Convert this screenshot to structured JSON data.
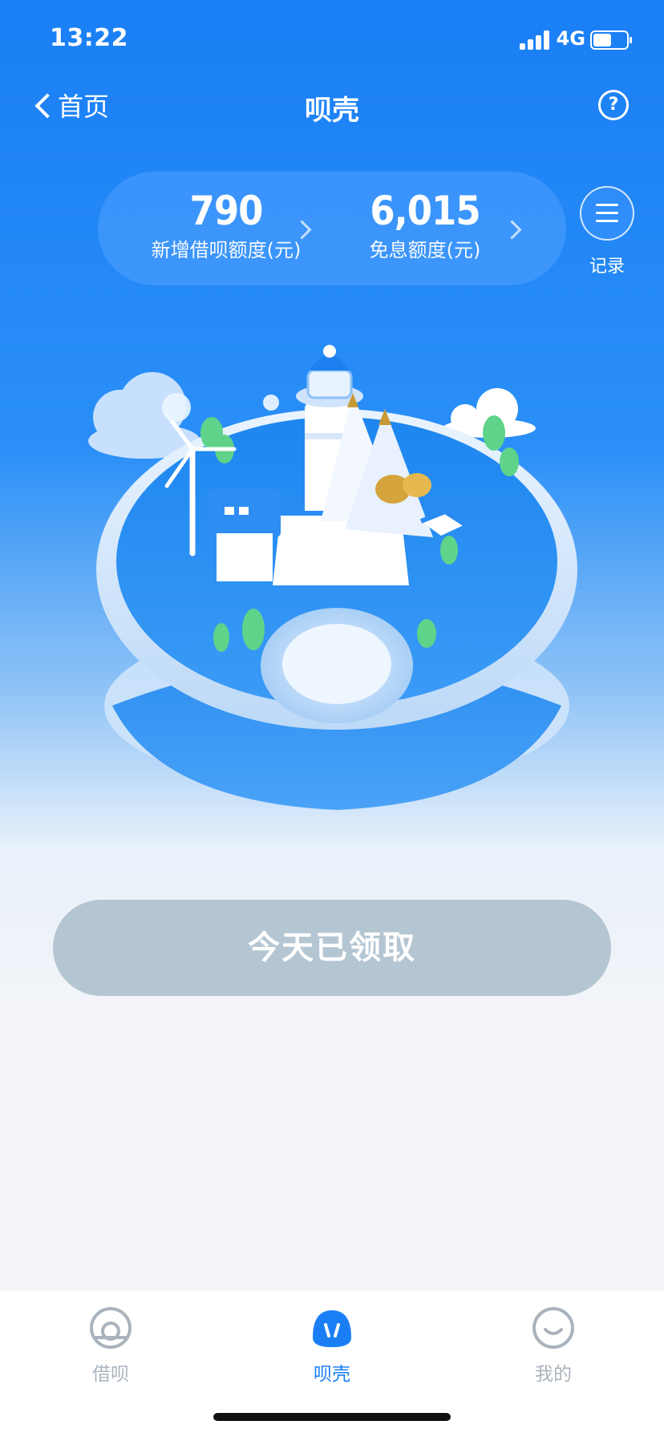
{
  "status_bar": {
    "time": "13:22",
    "network": "4G"
  },
  "nav": {
    "back_label": "首页",
    "title": "呗壳",
    "help_symbol": "?"
  },
  "summary": {
    "new_credit_value": "790",
    "new_credit_label": "新增借呗额度(元)",
    "interest_free_value": "6,015",
    "interest_free_label": "免息额度(元)"
  },
  "records": {
    "label": "记录",
    "icon": "menu-icon"
  },
  "claim_button": {
    "label": "今天已领取",
    "state": "disabled"
  },
  "tabbar": {
    "items": [
      {
        "label": "借呗",
        "icon": "jiebei-icon",
        "active": false
      },
      {
        "label": "呗壳",
        "icon": "beike-shell-icon",
        "active": true
      },
      {
        "label": "我的",
        "icon": "smile-face-icon",
        "active": false
      }
    ]
  },
  "colors": {
    "primary": "#1a7ff5",
    "button_disabled": "#b5c6d3",
    "tab_inactive": "#aab3bd"
  }
}
